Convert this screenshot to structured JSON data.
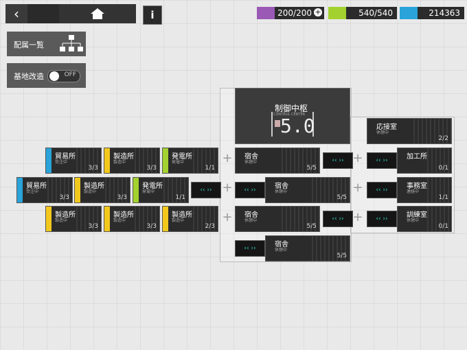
{
  "nav": {
    "back_icon": "chevron-left-icon",
    "home_icon": "home-icon",
    "info_label": "i"
  },
  "resources": {
    "drones": {
      "value": "200/200",
      "icon": "drone-icon",
      "color": "#9b59b6"
    },
    "power": {
      "value": "540/540",
      "icon": "power-icon",
      "color": "#a3d12f"
    },
    "lmd": {
      "value": "214363",
      "icon": "lmd-icon",
      "color": "#29a3d9"
    }
  },
  "side": {
    "assignment_label": "配属一覧",
    "renovation_label": "基地改造",
    "renovation_state": "OFF"
  },
  "control_center": {
    "name": "制御中枢",
    "subtitle": "CONTROL CENTER",
    "level": "5.0"
  },
  "rooms_left": [
    {
      "name": "貿易所",
      "sub": "受注中",
      "count": "3",
      "cap": "/3",
      "color": "#29a3d9"
    },
    {
      "name": "製造所",
      "sub": "製造中",
      "count": "3",
      "cap": "/3",
      "color": "#f2c81d"
    },
    {
      "name": "発電所",
      "sub": "発電中",
      "count": "1",
      "cap": "/1",
      "color": "#a3d12f"
    },
    {
      "name": "貿易所",
      "sub": "受注中",
      "count": "3",
      "cap": "/3",
      "color": "#29a3d9"
    },
    {
      "name": "製造所",
      "sub": "製造中",
      "count": "3",
      "cap": "/3",
      "color": "#f2c81d"
    },
    {
      "name": "発電所",
      "sub": "発電中",
      "count": "1",
      "cap": "/1",
      "color": "#a3d12f"
    },
    {
      "name": "製造所",
      "sub": "製造中",
      "count": "3",
      "cap": "/3",
      "color": "#f2c81d"
    },
    {
      "name": "製造所",
      "sub": "製造中",
      "count": "3",
      "cap": "/3",
      "color": "#f2c81d"
    },
    {
      "name": "製造所",
      "sub": "製造中",
      "count": "2",
      "cap": "/3",
      "color": "#f2c81d"
    }
  ],
  "dorms": [
    {
      "name": "宿舎",
      "sub": "休憩中",
      "count": "5",
      "cap": "/5"
    },
    {
      "name": "宿舎",
      "sub": "休憩中",
      "count": "5",
      "cap": "/5"
    },
    {
      "name": "宿舎",
      "sub": "休憩中",
      "count": "5",
      "cap": "/5"
    },
    {
      "name": "宿舎",
      "sub": "休憩中",
      "count": "5",
      "cap": "/5"
    }
  ],
  "rooms_right": [
    {
      "name": "応接室",
      "sub": "休憩中",
      "count": "2",
      "cap": "/2"
    },
    {
      "name": "加工所",
      "sub": "",
      "count": "0",
      "cap": "/1"
    },
    {
      "name": "事務室",
      "sub": "連絡中",
      "count": "1",
      "cap": "/1"
    },
    {
      "name": "訓練室",
      "sub": "休憩中",
      "count": "0",
      "cap": "/1"
    }
  ],
  "corridor_label": "‹‹ ››"
}
